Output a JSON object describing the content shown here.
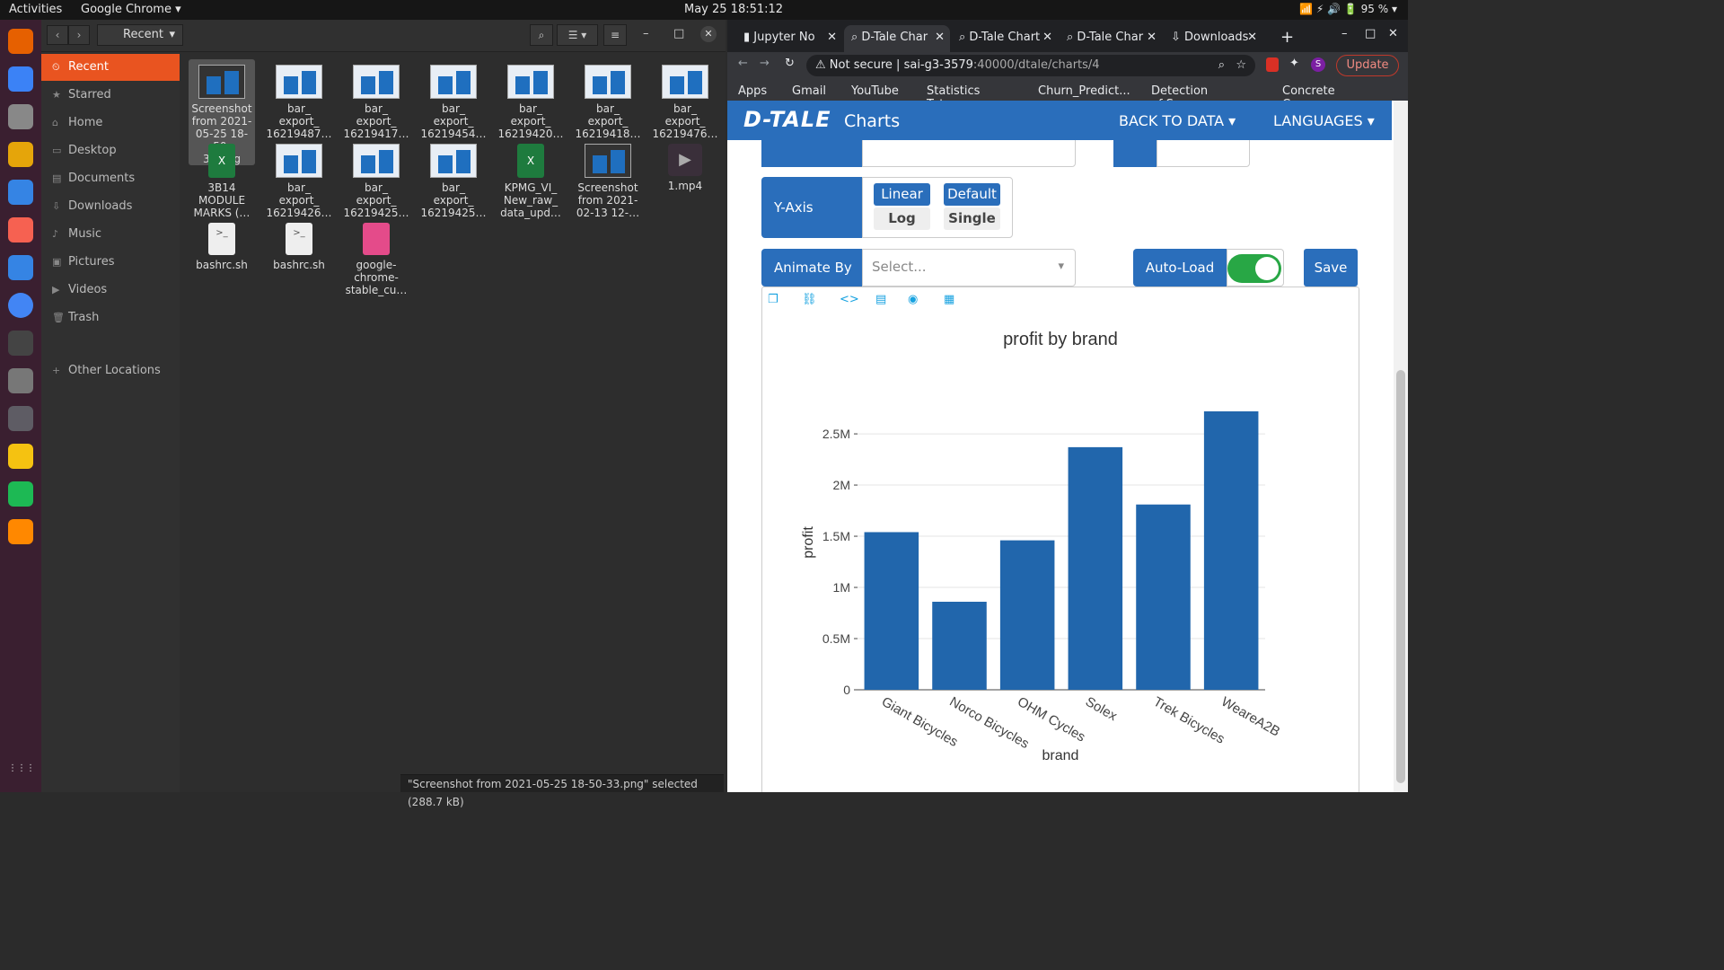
{
  "topbar": {
    "activities": "Activities",
    "app": "Google Chrome",
    "clock": "May 25  18:51:12",
    "battery": "95 %"
  },
  "dock": [
    "firefox-icon",
    "thunderbird-icon",
    "files-icon",
    "rhythmbox-icon",
    "writer-icon",
    "software-icon",
    "help-icon",
    "chrome-icon",
    "terminal-icon",
    "settings-icon",
    "atom-icon",
    "calculator-icon",
    "spotify-icon",
    "vlc-icon",
    "apps-grid-icon"
  ],
  "files": {
    "location": "Recent",
    "sidebar": [
      {
        "label": "Recent",
        "icon": "⏲"
      },
      {
        "label": "Starred",
        "icon": "★"
      },
      {
        "label": "Home",
        "icon": "⌂"
      },
      {
        "label": "Desktop",
        "icon": "▭"
      },
      {
        "label": "Documents",
        "icon": "▤"
      },
      {
        "label": "Downloads",
        "icon": "⇩"
      },
      {
        "label": "Music",
        "icon": "♪"
      },
      {
        "label": "Pictures",
        "icon": "▣"
      },
      {
        "label": "Videos",
        "icon": "▶"
      },
      {
        "label": "Trash",
        "icon": "🗑"
      },
      {
        "label": "Other Locations",
        "icon": "+"
      }
    ],
    "items": [
      {
        "name": "Screenshot from 2021-05-25 18-50-33.png",
        "lines": [
          "Screenshot",
          "from 2021-",
          "05-25 18-50-",
          "33.png"
        ],
        "kind": "shot"
      },
      {
        "name": "bar_ export_ 16219487…",
        "lines": [
          "bar_",
          "export_",
          "16219487…"
        ],
        "kind": "thumb"
      },
      {
        "name": "bar_ export_ 16219417…",
        "lines": [
          "bar_",
          "export_",
          "16219417…"
        ],
        "kind": "thumb"
      },
      {
        "name": "bar_ export_ 16219454…",
        "lines": [
          "bar_",
          "export_",
          "16219454…"
        ],
        "kind": "thumb"
      },
      {
        "name": "bar_ export_ 16219420…",
        "lines": [
          "bar_",
          "export_",
          "16219420…"
        ],
        "kind": "thumb"
      },
      {
        "name": "bar_ export_ 16219418…",
        "lines": [
          "bar_",
          "export_",
          "16219418…"
        ],
        "kind": "thumb"
      },
      {
        "name": "bar_ export_ 16219476…",
        "lines": [
          "bar_",
          "export_",
          "16219476…"
        ],
        "kind": "thumb"
      },
      {
        "name": "3B14 MODULE MARKS (…",
        "lines": [
          "3B14",
          "MODULE",
          "MARKS (…"
        ],
        "kind": "xls"
      },
      {
        "name": "bar_ export_ 16219426…",
        "lines": [
          "bar_",
          "export_",
          "16219426…"
        ],
        "kind": "thumb"
      },
      {
        "name": "bar_ export_ 16219425…",
        "lines": [
          "bar_",
          "export_",
          "16219425…"
        ],
        "kind": "thumb"
      },
      {
        "name": "bar_ export_ 16219425…",
        "lines": [
          "bar_",
          "export_",
          "16219425…"
        ],
        "kind": "thumb"
      },
      {
        "name": "KPMG_VI_ New_raw_ data_upd…",
        "lines": [
          "KPMG_VI_",
          "New_raw_",
          "data_upd…"
        ],
        "kind": "xls"
      },
      {
        "name": "Screenshot from 2021- 02-13 12-…",
        "lines": [
          "Screenshot",
          "from 2021-",
          "02-13 12-…"
        ],
        "kind": "shot"
      },
      {
        "name": "1.mp4",
        "lines": [
          "1.mp4"
        ],
        "kind": "video"
      },
      {
        "name": "bashrc.sh",
        "lines": [
          "bashrc.sh"
        ],
        "kind": "sh"
      },
      {
        "name": "bashrc.sh",
        "lines": [
          "bashrc.sh"
        ],
        "kind": "sh"
      },
      {
        "name": "google- chrome- stable_cu…",
        "lines": [
          "google-",
          "chrome-",
          "stable_cu…"
        ],
        "kind": "deb"
      }
    ],
    "status": "\"Screenshot from 2021-05-25 18-50-33.png\" selected  (288.7 kB)"
  },
  "browser": {
    "tabs": [
      "Jupyter No",
      "D-Tale Char",
      "D-Tale Chart",
      "D-Tale Char",
      "Downloads"
    ],
    "url_prefix": "Not secure",
    "url_host": "sai-g3-3579",
    "url_path": ":40000/dtale/charts/4",
    "update": "Update",
    "bookmarks": [
      "Apps",
      "Gmail",
      "YouTube",
      "Statistics Tuto...",
      "Churn_Predict...",
      "Detection of S...",
      "Concrete C..."
    ]
  },
  "dtale": {
    "logo": "D-TALE",
    "title": "Charts",
    "back": "BACK TO DATA",
    "languages": "LANGUAGES",
    "yaxis": "Y-Axis",
    "linear": "Linear",
    "log": "Log",
    "default": "Default",
    "single": "Single",
    "animate_by": "Animate By",
    "animate_placeholder": "Select...",
    "autoload": "Auto-Load",
    "save": "Save"
  },
  "chart_data": {
    "type": "bar",
    "title": "profit by brand",
    "xlabel": "brand",
    "ylabel": "profit",
    "categories": [
      "Giant Bicycles",
      "Norco Bicycles",
      "OHM Cycles",
      "Solex",
      "Trek Bicycles",
      "WeareA2B"
    ],
    "values": [
      1540000,
      860000,
      1460000,
      2370000,
      1810000,
      2720000
    ],
    "ylim": [
      0,
      2720000
    ],
    "yticks": [
      0,
      500000,
      1000000,
      1500000,
      2000000,
      2500000
    ],
    "ytick_labels": [
      "0",
      "0.5M",
      "1M",
      "1.5M",
      "2M",
      "2.5M"
    ],
    "color": "#2166ac"
  }
}
